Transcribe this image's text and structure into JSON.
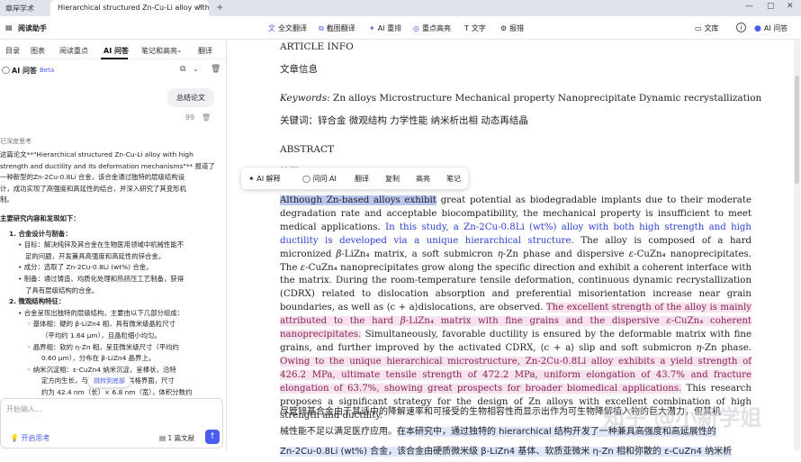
{
  "window": {
    "tab_home": "章岸学术",
    "tab_doc": "Hierarchical structured Zn-Cu-Li alloy with ...",
    "close": "✕",
    "new_tab": "+",
    "min": "—",
    "max": "▢",
    "close_win": "✕"
  },
  "toolbar": {
    "title": "阅读助手",
    "full_translate": "全文翻译",
    "screenshot_translate": "截图翻译",
    "ai_rearrange": "AI 重排",
    "key_highlight": "重点高亮",
    "text": "文字",
    "report": "报错",
    "library": "文库",
    "ai_qa": "AI 问答",
    "info": "i"
  },
  "sidebar": {
    "tabs": [
      "目录",
      "图表",
      "阅读重点",
      "AI 问答",
      "笔记和高亮",
      "翻译"
    ],
    "ai_title": "AI 问答",
    "beta": "Beta",
    "user_msg": "总结论文",
    "thought": "已深度思考",
    "answer": [
      "这篇论文**\"Hierarchical structured Zn-Cu-Li alloy with high",
      "strength and ductility and its deformation mechanisms\"** 报道了",
      "一种新型的Zn-2Cu-0.8Li 合金，该合金通过独特的层级结构设",
      "计，成功实现了高强度和高延性的结合，并深入研究了其变形机",
      "制。"
    ],
    "h1": "主要研究内容和发现如下：",
    "s1": "1. 合金设计与制备：",
    "s1a": "• 目标：解决纯锌及其合金在生物医用领域中机械性能不",
    "s1a2": "足的问题，开发兼具高强度和高延性的锌合金。",
    "s1b": "• 成分：选取了 Zn-2Cu-0.8Li (wt%) 合金。",
    "s1c": "• 制备：通过铸造、均质化处理和热挤压工艺制备，获得",
    "s1c2": "了具有层级结构的合金。",
    "s2": "2. 微观结构特征：",
    "s2a": "• 合金呈现出独特的层级结构，主要由以下几部分组成：",
    "s2b": "◦ 基体相：硬的 β-LiZn4 相，具有微米级晶粒尺寸",
    "s2b2": "（平均约 1.64 μm），且晶粒细小均匀。",
    "s2c": "◦ 晶界相：软的 η-Zn 相，呈亚微米级尺寸（平均约",
    "s2c2": "0.60 μm），分布在 β-LiZn4 晶界上。",
    "s2d": "◦ 纳米沉淀相：ε-CuZn4 纳米沉淀，呈棒状，沿特",
    "s2d2": "定方向生长，与基体形成具有共格界面，尺寸",
    "s2d3": "约为 42.4 nm（长）× 6.8 nm（宽），体积分数约",
    "jump": "跳转到底部",
    "input_placeholder": "开始输入...",
    "deep_think": "开启思考",
    "doc_count": "1 篇文献"
  },
  "document": {
    "article_info": "ARTICLE INFO",
    "article_info_zh": "文章信息",
    "keywords_label": "Keywords:",
    "keywords": "Zn alloys Microstructure Mechanical property Nanoprecipitate Dynamic recrystallization",
    "keywords_zh": "关键词：锌合金 微观结构 力学性能 纳米析出相 动态再结晶",
    "abstract": "ABSTRACT",
    "abstract_zh": "摘要",
    "popup": [
      "AI 解释",
      "问问 AI",
      "翻译",
      "复制",
      "高亮",
      "笔记"
    ],
    "zh_line1": "尽管锌基合金由于其适中的降解速率和可接受的生物相容性而显示出作为可生物降解植入物的巨大潜力，但其机",
    "zh_line2a": "械性能不足以满足医疗应用。",
    "zh_line2b": "在本研究中，通过独特的 hierarchical 结构开发了一种兼具高强度和高延展性的",
    "zh_line3": "Zn-2Cu-0.8Li (wt%) 合金，该合金由硬质微米级 β-LiZn4 基体、软质亚微米 η-Zn 相和弥散的 ε-CuZn4 纳米析"
  },
  "watermark": "知乎 @小新学姐"
}
